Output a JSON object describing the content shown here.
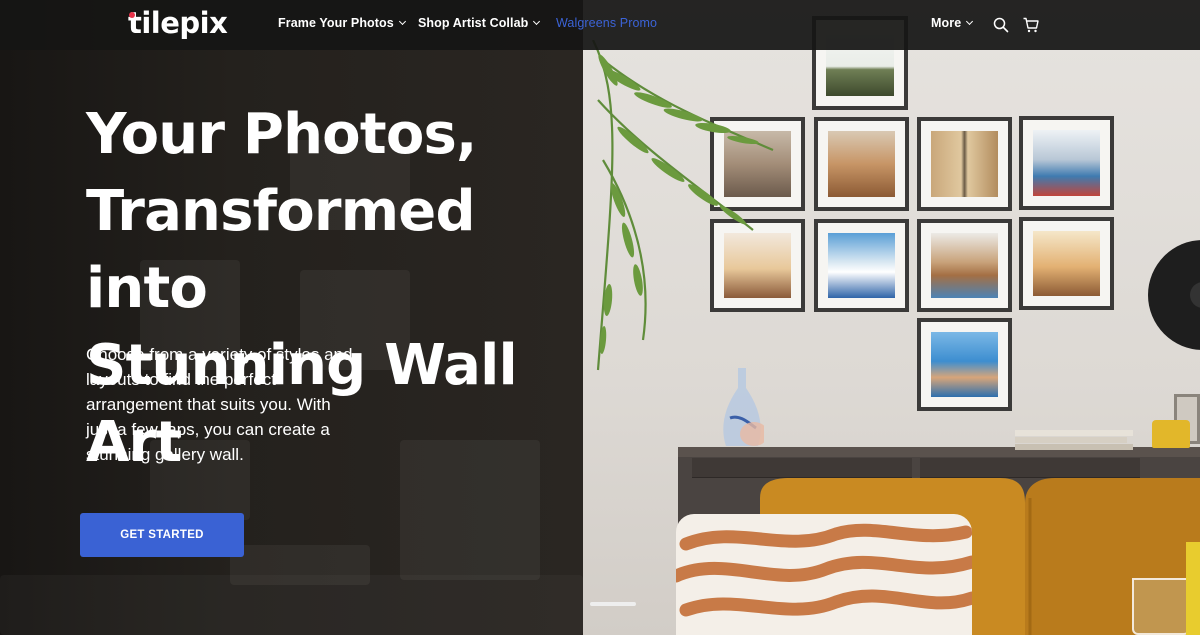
{
  "brand": {
    "name": "tilepix"
  },
  "nav": {
    "items": [
      {
        "label": "Frame Your Photos",
        "has_dropdown": true
      },
      {
        "label": "Shop Artist Collab",
        "has_dropdown": true
      },
      {
        "label": "Walgreens Promo",
        "has_dropdown": false
      },
      {
        "label": "More",
        "has_dropdown": true
      }
    ],
    "icons": [
      "search-icon",
      "cart-icon"
    ]
  },
  "hero": {
    "headline_lines": [
      "Your Photos,",
      "Transformed into",
      "Stunning Wall Art"
    ],
    "subtext": "Choose from a variety of styles and layouts to find the perfect arrangement that suits you. With just a few taps, you can create a stunning gallery wall.",
    "cta_label": "GET STARTED"
  },
  "colors": {
    "accent": "#3a62d4",
    "link": "#3b63d6",
    "nav_bg": "#161514",
    "logo_dot": "#e8334a"
  }
}
